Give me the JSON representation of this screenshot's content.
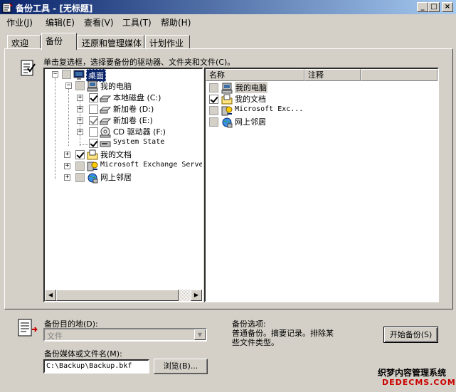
{
  "window": {
    "title": "备份工具 - [无标题]",
    "minimize": "_",
    "maximize": "□",
    "close": "×"
  },
  "menu": [
    "作业(J)",
    "编辑(E)",
    "查看(V)",
    "工具(T)",
    "帮助(H)"
  ],
  "tabs": [
    "欢迎",
    "备份",
    "还原和管理媒体",
    "计划作业"
  ],
  "backup_tab": {
    "instruction": "单击复选框，选择要备份的驱动器、文件夹和文件(C)。",
    "tree": {
      "desktop": "桌面",
      "my_computer": "我的电脑",
      "local_disk": "本地磁盘 (C:)",
      "new_volume_d": "新加卷 (D:)",
      "new_volume_e": "新加卷 (E:)",
      "cd_drive": "CD 驱动器 (F:)",
      "system_state": "System State",
      "my_documents": "我的文档",
      "exchange": "Microsoft Exchange Serve",
      "network": "网上邻居"
    },
    "list": {
      "columns": [
        "名称",
        "注释"
      ],
      "items": [
        "我的电脑",
        "我的文档",
        "Microsoft Exc...",
        "网上邻居"
      ]
    }
  },
  "bottom": {
    "destination_label": "备份目的地(D):",
    "destination_value": "文件",
    "media_label": "备份媒体或文件名(M):",
    "media_value": "C:\\Backup\\Backup.bkf",
    "browse_button": "浏览(B)...",
    "options_label": "备份选项:",
    "options_text_1": "普通备份。摘要记录。排除某",
    "options_text_2": "些文件类型。",
    "start_button": "开始备份(S)"
  },
  "watermark": {
    "line1": "织梦内容管理系统",
    "line2": "DEDECMS.COM"
  },
  "colors": {
    "titlebar": "#0a246a",
    "face": "#d4d0c8",
    "selection": "#0a246a"
  }
}
